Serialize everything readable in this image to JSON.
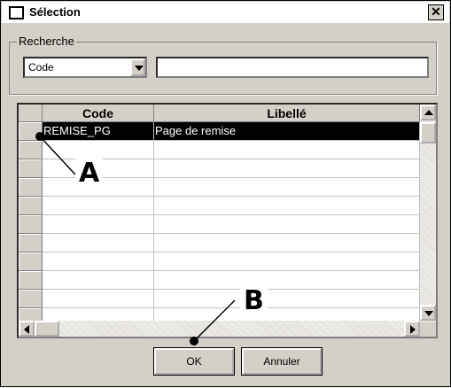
{
  "window": {
    "title": "Sélection",
    "close_label": "✕"
  },
  "search_group": {
    "label": "Recherche",
    "field_select": {
      "value": "Code",
      "options": [
        "Code"
      ]
    },
    "search_text": {
      "value": ""
    }
  },
  "grid": {
    "columns": [
      "Code",
      "Libellé"
    ],
    "rows": [
      {
        "code": "REMISE_PG",
        "libelle": "Page de remise",
        "selected": true
      },
      {
        "code": "",
        "libelle": ""
      },
      {
        "code": "",
        "libelle": ""
      },
      {
        "code": "",
        "libelle": ""
      },
      {
        "code": "",
        "libelle": ""
      },
      {
        "code": "",
        "libelle": ""
      },
      {
        "code": "",
        "libelle": ""
      },
      {
        "code": "",
        "libelle": ""
      },
      {
        "code": "",
        "libelle": ""
      },
      {
        "code": "",
        "libelle": ""
      },
      {
        "code": "",
        "libelle": ""
      }
    ]
  },
  "buttons": {
    "ok": "OK",
    "cancel": "Annuler"
  },
  "annotations": {
    "a": "A",
    "b": "B"
  },
  "colors": {
    "window_bg": "#d4d0c8",
    "selection_bg": "#000000",
    "selection_text": "#ffffff"
  },
  "icons": {
    "close": "close-icon",
    "scroll_up": "arrow-up-icon",
    "scroll_down": "arrow-down-icon",
    "scroll_left": "arrow-left-icon",
    "scroll_right": "arrow-right-icon",
    "combo": "chevron-down-icon"
  }
}
